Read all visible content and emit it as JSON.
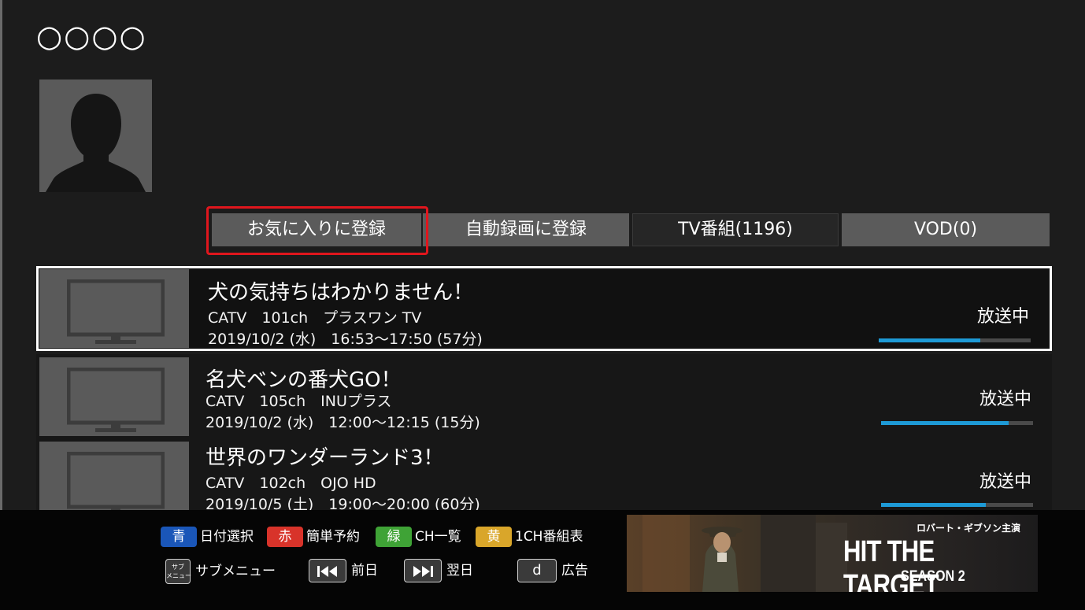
{
  "header": {
    "title": "○○○○"
  },
  "tabs": [
    {
      "label": "お気に入りに登録"
    },
    {
      "label": "自動録画に登録"
    },
    {
      "label": "TV番組(1196)"
    },
    {
      "label": "VOD(0)"
    }
  ],
  "programs": [
    {
      "title": "犬の気持ちはわかりません！",
      "channel": "CATV　101ch　プラスワン TV",
      "time": "2019/10/2 (水)　16:53～17:50 (57分)",
      "status": "放送中",
      "progress": 0.67
    },
    {
      "title": "名犬ベンの番犬GO！",
      "channel": "CATV　105ch　INUプラス",
      "time": "2019/10/2 (水)　12:00～12:15 (15分)",
      "status": "放送中",
      "progress": 0.84
    },
    {
      "title": "世界のワンダーランド3！",
      "channel": "CATV　102ch　OJO HD",
      "time": "2019/10/5 (土)　19:00～20:00 (60分)",
      "status": "放送中",
      "progress": 0.69
    }
  ],
  "footer": {
    "color_keys": [
      {
        "badge": "青",
        "label": "日付選択",
        "color": "#1a56b8"
      },
      {
        "badge": "赤",
        "label": "簡単予約",
        "color": "#d8332a"
      },
      {
        "badge": "緑",
        "label": "CH一覧",
        "color": "#3fa336"
      },
      {
        "badge": "黄",
        "label": "1CH番組表",
        "color": "#d9a62a"
      }
    ],
    "sub_menu": {
      "cap": "サブ\nメニュー",
      "label": "サブメニュー"
    },
    "prev_day": {
      "label": "前日"
    },
    "next_day": {
      "label": "翌日"
    },
    "d_key": {
      "cap": "d",
      "label": "広告"
    }
  },
  "ad": {
    "top_text": "ロバート・ギブソン主演",
    "title": "HIT THE TARGET",
    "season": "SEASON 2"
  },
  "colors": {
    "focus": "#e0161d",
    "progress": "#1e9ad6",
    "tab": "#5b5b5b"
  }
}
